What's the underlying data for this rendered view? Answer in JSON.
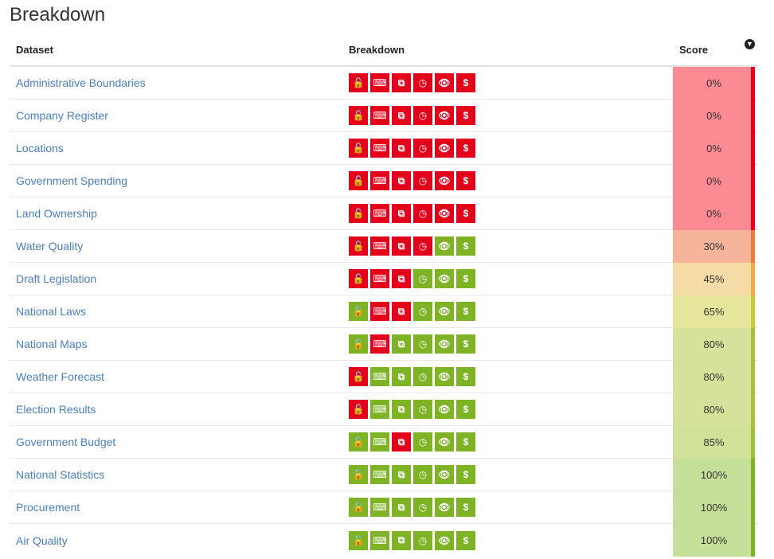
{
  "page": {
    "title": "Breakdown"
  },
  "table": {
    "headers": {
      "dataset": "Dataset",
      "breakdown": "Breakdown",
      "score": "Score"
    },
    "icon_order": [
      "unlock-icon",
      "keyboard-icon",
      "copy-icon",
      "clock-icon",
      "eye-icon",
      "dollar-icon"
    ],
    "icon_glyphs": [
      "🔓",
      "⌨",
      "⧉",
      "◷",
      "👁",
      "$"
    ],
    "colors": {
      "red": "#e3001b",
      "green": "#7db325"
    },
    "rows": [
      {
        "name": "Administrative Boundaries",
        "score": "0%",
        "icons": [
          "red",
          "red",
          "red",
          "red",
          "red",
          "red"
        ],
        "bg": "#fc8a93",
        "bar": "#e3001b"
      },
      {
        "name": "Company Register",
        "score": "0%",
        "icons": [
          "red",
          "red",
          "red",
          "red",
          "red",
          "red"
        ],
        "bg": "#fc8a93",
        "bar": "#e3001b"
      },
      {
        "name": "Locations",
        "score": "0%",
        "icons": [
          "red",
          "red",
          "red",
          "red",
          "red",
          "red"
        ],
        "bg": "#fc8a93",
        "bar": "#e3001b"
      },
      {
        "name": "Government Spending",
        "score": "0%",
        "icons": [
          "red",
          "red",
          "red",
          "red",
          "red",
          "red"
        ],
        "bg": "#fc8a93",
        "bar": "#e3001b"
      },
      {
        "name": "Land Ownership",
        "score": "0%",
        "icons": [
          "red",
          "red",
          "red",
          "red",
          "red",
          "red"
        ],
        "bg": "#fc8a93",
        "bar": "#e3001b"
      },
      {
        "name": "Water Quality",
        "score": "30%",
        "icons": [
          "red",
          "red",
          "red",
          "red",
          "green",
          "green"
        ],
        "bg": "#f6b59b",
        "bar": "#ee7b3d"
      },
      {
        "name": "Draft Legislation",
        "score": "45%",
        "icons": [
          "red",
          "red",
          "red",
          "green",
          "green",
          "green"
        ],
        "bg": "#f5dba6",
        "bar": "#f2ae3e"
      },
      {
        "name": "National Laws",
        "score": "65%",
        "icons": [
          "green",
          "red",
          "red",
          "green",
          "green",
          "green"
        ],
        "bg": "#e6e59c",
        "bar": "#c9cc3a"
      },
      {
        "name": "National Maps",
        "score": "80%",
        "icons": [
          "green",
          "red",
          "green",
          "green",
          "green",
          "green"
        ],
        "bg": "#d4e29b",
        "bar": "#a7c23a"
      },
      {
        "name": "Weather Forecast",
        "score": "80%",
        "icons": [
          "red",
          "green",
          "green",
          "green",
          "green",
          "green"
        ],
        "bg": "#d4e29b",
        "bar": "#a7c23a"
      },
      {
        "name": "Election Results",
        "score": "80%",
        "icons": [
          "red",
          "green",
          "green",
          "green",
          "green",
          "green"
        ],
        "bg": "#d4e29b",
        "bar": "#a7c23a"
      },
      {
        "name": "Government Budget",
        "score": "85%",
        "icons": [
          "green",
          "green",
          "red",
          "green",
          "green",
          "green"
        ],
        "bg": "#d0e299",
        "bar": "#9cc23a"
      },
      {
        "name": "National Statistics",
        "score": "100%",
        "icons": [
          "green",
          "green",
          "green",
          "green",
          "green",
          "green"
        ],
        "bg": "#c6df98",
        "bar": "#7db325"
      },
      {
        "name": "Procurement",
        "score": "100%",
        "icons": [
          "green",
          "green",
          "green",
          "green",
          "green",
          "green"
        ],
        "bg": "#c6df98",
        "bar": "#7db325"
      },
      {
        "name": "Air Quality",
        "score": "100%",
        "icons": [
          "green",
          "green",
          "green",
          "green",
          "green",
          "green"
        ],
        "bg": "#c6df98",
        "bar": "#7db325"
      }
    ]
  }
}
